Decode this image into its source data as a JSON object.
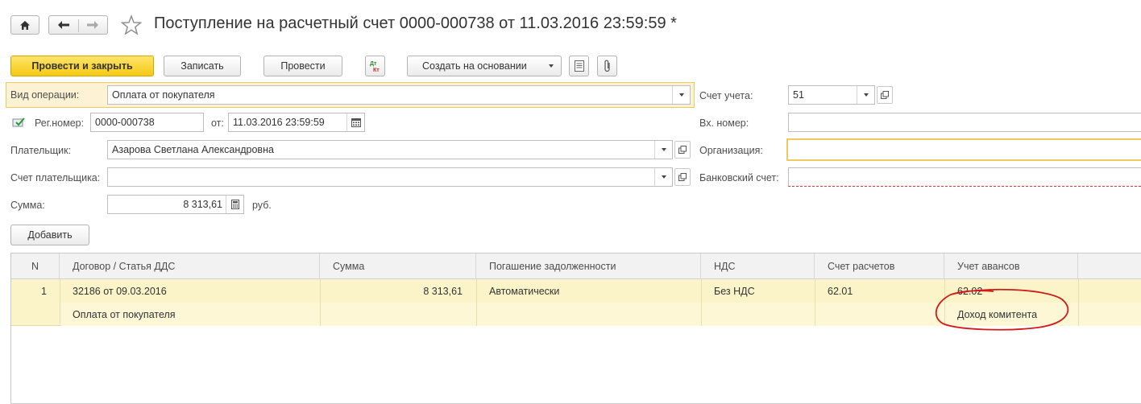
{
  "header": {
    "title": "Поступление на расчетный счет 0000-000738 от 11.03.2016 23:59:59 *"
  },
  "toolbar": {
    "post_and_close": "Провести и закрыть",
    "save": "Записать",
    "post": "Провести",
    "dt_kt_icon_label": "Дт Кт",
    "create_based_on": "Создать на основании"
  },
  "form": {
    "operation_type_label": "Вид операции:",
    "operation_type_value": "Оплата от покупателя",
    "reg_number_label": "Рег.номер:",
    "reg_number_value": "0000-000738",
    "date_label": "от:",
    "date_value": "11.03.2016 23:59:59",
    "payer_label": "Плательщик:",
    "payer_value": "Азарова Светлана Александровна",
    "payer_account_label": "Счет плательщика:",
    "payer_account_value": "",
    "sum_label": "Сумма:",
    "sum_value": "8 313,61",
    "currency": "руб.",
    "account_label": "Счет учета:",
    "account_value": "51",
    "incoming_number_label": "Вх. номер:",
    "incoming_number_value": "",
    "organization_label": "Организация:",
    "organization_value": "",
    "bank_account_label": "Банковский счет:",
    "bank_account_value": ""
  },
  "add_button": "Добавить",
  "table": {
    "columns": [
      "N",
      "Договор / Статья ДДС",
      "Сумма",
      "Погашение задолженности",
      "НДС",
      "Счет расчетов",
      "Учет авансов"
    ],
    "rows": [
      {
        "n": "1",
        "contract": "32186 от 09.03.2016",
        "dds_item": "Оплата от покупателя",
        "sum": "8 313,61",
        "repayment": "Автоматически",
        "vat": "Без НДС",
        "settlement_account": "62.01",
        "advance_account": "62.02",
        "advance_subconto": "Доход комитента"
      }
    ]
  },
  "colors": {
    "primary_button": "#f6c913",
    "selected_row": "#fbf4c8",
    "annotation": "#d11a1a",
    "highlight_border": "#f0c860"
  }
}
